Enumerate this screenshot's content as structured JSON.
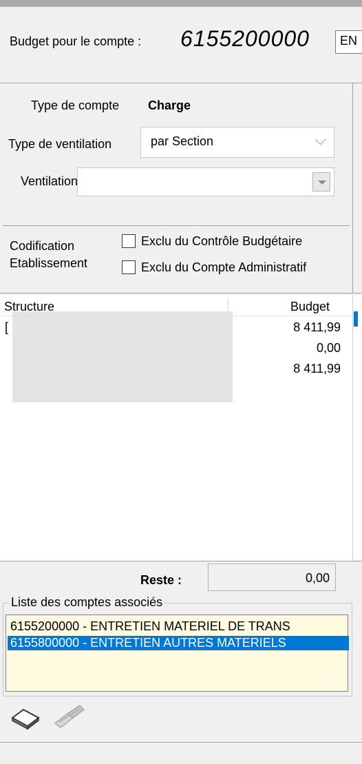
{
  "header": {
    "label": "Budget pour le compte :",
    "account_number": "6155200000",
    "right_field_value": "EN"
  },
  "account_info": {
    "type_compte_label": "Type de compte",
    "type_compte_value": "Charge",
    "type_ventilation_label": "Type de ventilation",
    "type_ventilation_value": "par Section",
    "ventilation_label": "Ventilation",
    "ventilation_value": ""
  },
  "codification": {
    "label_line1": "Codification",
    "label_line2": "Etablissement",
    "checkbox1_label": "Exclu du Contrôle Budgétaire",
    "checkbox1_checked": false,
    "checkbox2_label": "Exclu du Compte Administratif",
    "checkbox2_checked": false
  },
  "grid": {
    "columns": [
      "Structure",
      "Budget"
    ],
    "rows": [
      {
        "structure": "[",
        "budget": "8 411,99"
      },
      {
        "structure": "",
        "budget": "0,00"
      },
      {
        "structure": "",
        "budget": "8 411,99"
      }
    ]
  },
  "reste": {
    "label": "Reste :",
    "value": "0,00"
  },
  "associated_accounts": {
    "legend": "Liste des comptes associés",
    "items": [
      {
        "text": "6155200000 - ENTRETIEN MATERIEL DE TRANS",
        "selected": false
      },
      {
        "text": "6155800000 - ENTRETIEN AUTRES MATERIELS",
        "selected": true
      }
    ]
  },
  "toolbar": {
    "icons": [
      "eraser-icon",
      "edit-disabled-icon"
    ]
  },
  "colors": {
    "selection": "#0078d7",
    "list_background": "#fffbe0",
    "window_background": "#f0f0f0"
  }
}
